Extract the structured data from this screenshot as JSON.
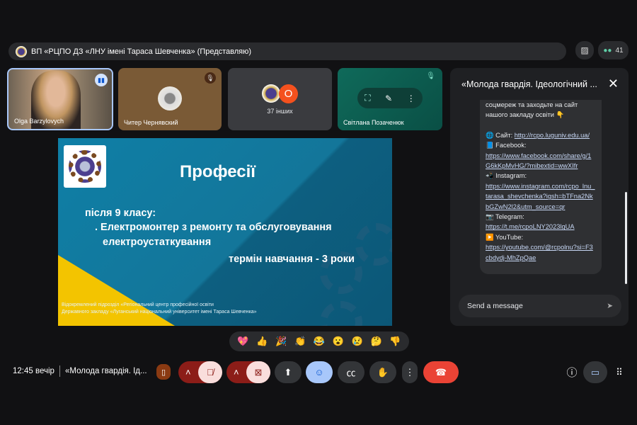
{
  "topbar": {
    "title": "ВП «РЦПО ДЗ «ЛНУ імені Тараса Шевченка» (Представляю)",
    "participant_count": "41"
  },
  "tiles": [
    {
      "name": "Olga Barzylovych",
      "speaking": true
    },
    {
      "name": "Читер Чернявский",
      "muted": true
    },
    {
      "name": "37 інших",
      "avatar_letter": "O"
    },
    {
      "name": "Світлана Позаченюк",
      "muted": true
    }
  ],
  "slide": {
    "title": "Професії",
    "line1": "після 9 класу:",
    "line2": ". Електромонтер з ремонту та обслуговування",
    "line3": "електроустаткування",
    "line4": "термін навчання - 3 роки",
    "footer1": "Відокремлений підрозділ «Регіональний центр професійної освіти",
    "footer2": "Державного закладу «Луганський національний університет імені Тараса Шевченка»"
  },
  "chat": {
    "title": "«Молода гвардія. Ідеологічний ...",
    "text1": "соцмереж та заходьте на сайт",
    "text2": "нашого закладу освіти 👇",
    "site_label": "🌐 Сайт: ",
    "site_url": "http://rcpo.luguniv.edu.ua/",
    "facebook_label": "📘 Facebook:",
    "facebook_url": "https://www.facebook.com/share/g/1G6kKpMvHG/?mibextid=wwXIfr",
    "instagram_label": "📲 Instagram:",
    "instagram_url": "https://www.instagram.com/rcpo_lnu_tarasa_shevchenka?igsh=bTFna2NkbGZwN2l2&utm_source=qr",
    "telegram_label": "📷 Telegram:",
    "telegram_url": "https://t.me/rcpoLNY2023lgUA",
    "youtube_label": "▶️ YouTube:",
    "youtube_url": "https://youtube.com/@rcpolnu?si=F3cbdydj-MhZpQae",
    "input_placeholder": "Send a message"
  },
  "reactions": [
    "💖",
    "👍",
    "🎉",
    "👏",
    "😂",
    "😮",
    "😢",
    "🤔",
    "👎"
  ],
  "bottom": {
    "time": "12:45 вечір",
    "meeting_title": "«Молода гвардія. Ід..."
  },
  "colors": {
    "accent_red": "#ea4335",
    "muted_bg": "#8c1d18",
    "active_blue": "#a8c7fa"
  }
}
